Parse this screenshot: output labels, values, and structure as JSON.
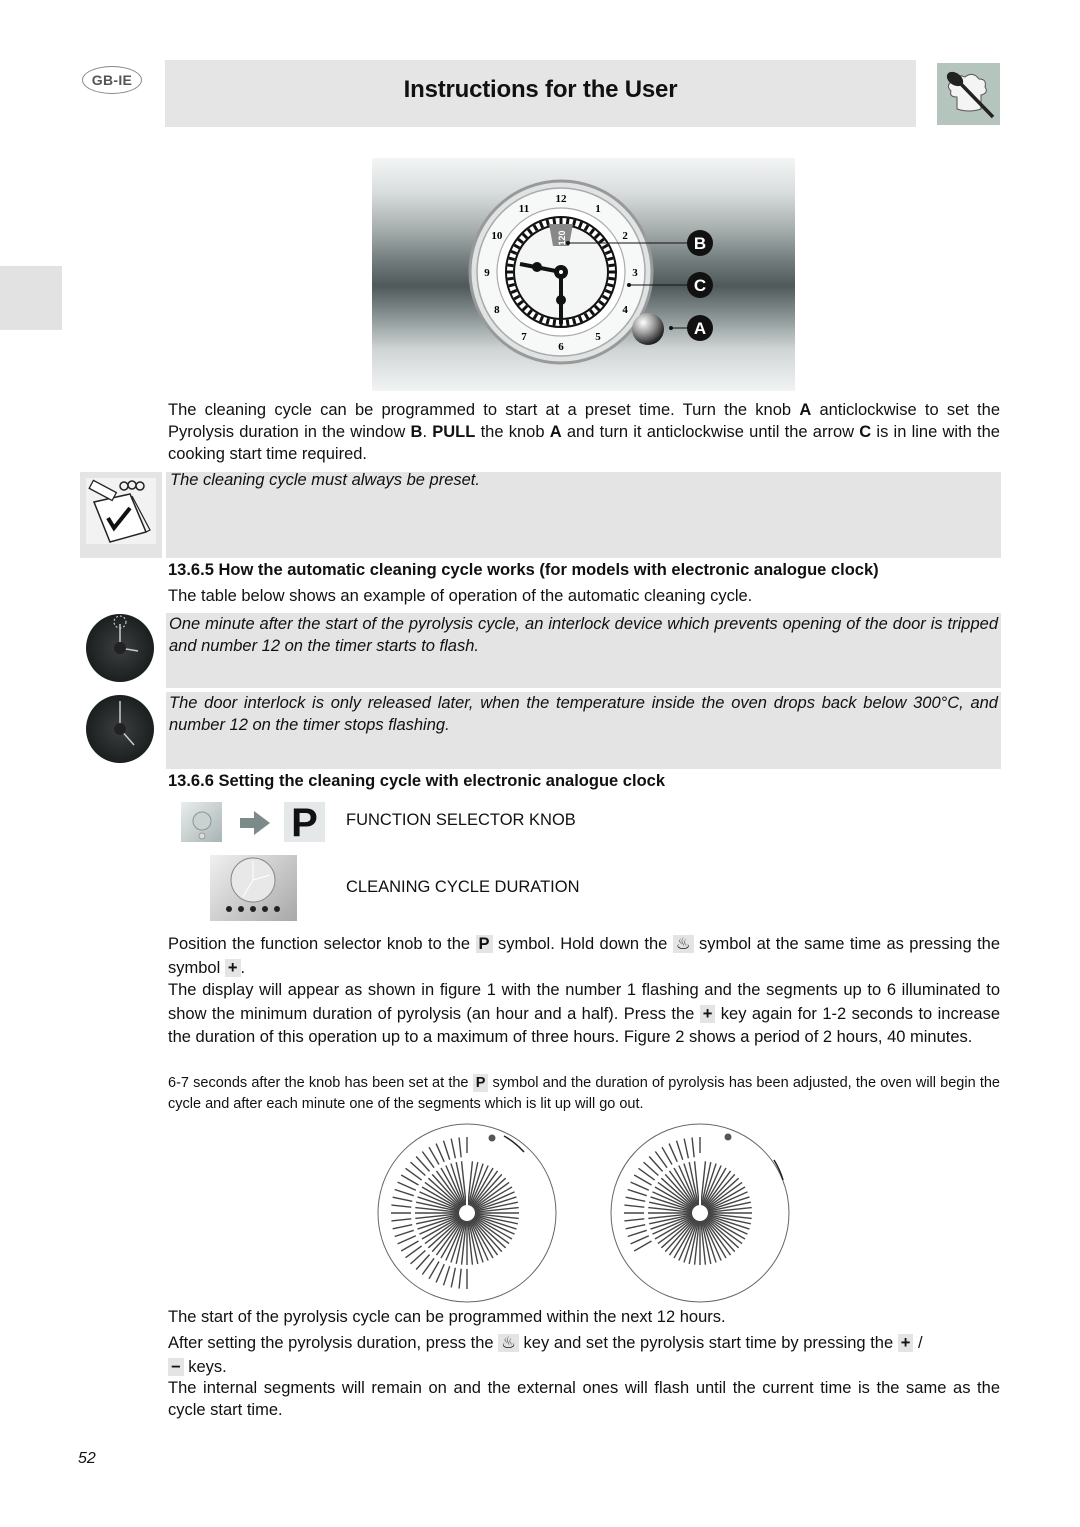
{
  "header": {
    "region_badge": "GB-IE",
    "title": "Instructions for the User",
    "chef_icon": "spoon-chef-hat-icon"
  },
  "figure_clock": {
    "labels": [
      "B",
      "C",
      "A"
    ],
    "hour_numbers": [
      "12",
      "1",
      "2",
      "3",
      "4",
      "5",
      "6",
      "7",
      "8",
      "9",
      "10",
      "11"
    ],
    "window_value": "120"
  },
  "intro": {
    "part1": "The cleaning cycle can be programmed to start at a preset time. Turn the knob ",
    "knob": "A",
    "part2": " anticlockwise to set the Pyrolysis duration in the window ",
    "window": "B",
    "part3": ". ",
    "pull": "PULL",
    "part4": " the knob ",
    "knob2": "A",
    "part5": " and turn it anticlockwise until the arrow ",
    "arrow": "C",
    "part6": " is in line with the cooking start time required."
  },
  "note": {
    "icon": "notepad-check-icon",
    "text": "The cleaning cycle must always be preset."
  },
  "section_1365": {
    "heading": "13.6.5  How the automatic cleaning cycle works (for models with electronic analogue clock)",
    "intro": "The table below shows an example of operation of the automatic cleaning cycle.",
    "rows": [
      {
        "icon": "clock-flashing-12-icon",
        "text": "One minute after the start of the pyrolysis cycle, an interlock device which prevents opening of the door is tripped and number 12 on the timer starts to flash."
      },
      {
        "icon": "clock-icon",
        "text": "The door interlock is only released later, when the temperature inside the oven drops back below 300°C, and number 12 on the timer stops flashing."
      }
    ]
  },
  "section_1366": {
    "heading": "13.6.6  Setting the cleaning cycle with electronic analogue clock",
    "function_selector_label": "FUNCTION SELECTOR KNOB",
    "p_symbol": "P",
    "cleaning_duration_label": "CLEANING CYCLE DURATION",
    "panel_buttons": [
      "○",
      "Δ",
      "⊙",
      "-",
      "+"
    ],
    "para1": {
      "a": "Position the function selector knob to the ",
      "p": "P",
      "b": " symbol. Hold down the ",
      "c": " symbol at the same time as pressing the symbol ",
      "plus": "+",
      "d": "."
    },
    "para2": {
      "a": "The display will appear as shown in figure 1 with the number 1 flashing and the segments up to 6 illuminated to show the minimum duration of pyrolysis (an hour and a half). Press the ",
      "plus": "+",
      "b": " key again for 1-2 seconds to increase the duration of this operation up to a maximum of three hours. Figure 2 shows a period of 2 hours, 40 minutes."
    },
    "para3": {
      "a": "6-7 seconds after the knob has been set at the ",
      "p": "P",
      "b": " symbol and the duration of pyrolysis has been adjusted, the oven will begin the cycle and after each minute one of the segments which is lit up will go out."
    },
    "figures": [
      {
        "name": "figure-1",
        "duration_hours": 1.5
      },
      {
        "name": "figure-2",
        "duration_hours": 2.6667
      }
    ],
    "para4": "The start of the pyrolysis cycle can be programmed within the next 12 hours.",
    "para5": {
      "a": "After setting the pyrolysis duration, press the ",
      "b": " key and set the pyrolysis start time by pressing the ",
      "plus": "+",
      "slash": " /",
      "minus": "−",
      "c": " keys."
    },
    "para6": "The internal segments will remain on and the external ones will flash until the current time is the same as the cycle start time."
  },
  "footer": {
    "page_number": "52"
  }
}
